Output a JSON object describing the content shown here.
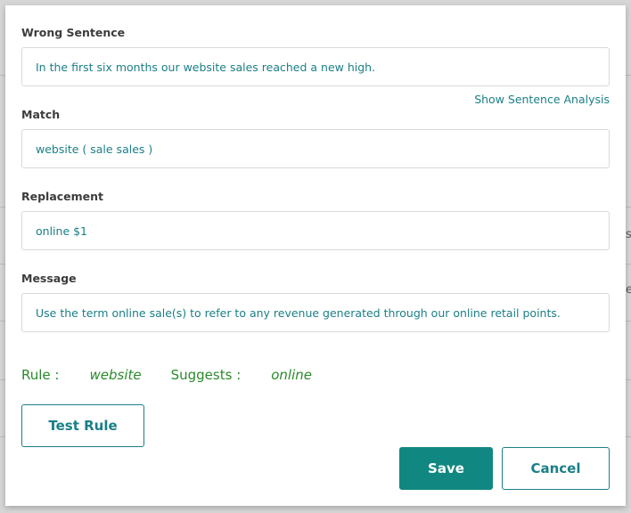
{
  "form": {
    "wrong_sentence": {
      "label": "Wrong Sentence",
      "value": "In the first six months our website sales reached a new high."
    },
    "show_analysis_label": "Show Sentence Analysis",
    "match": {
      "label": "Match",
      "value": "website ( sale sales )"
    },
    "replacement": {
      "label": "Replacement",
      "value": "online $1"
    },
    "message": {
      "label": "Message",
      "value": "Use the term online sale(s) to refer to any revenue generated through our online retail points."
    }
  },
  "rule_summary": {
    "rule_key": "Rule :",
    "rule_value": "website",
    "suggests_key": "Suggests :",
    "suggests_value": "online"
  },
  "buttons": {
    "test_rule": "Test Rule",
    "save": "Save",
    "cancel": "Cancel"
  },
  "background": {
    "glyph_1": "s.",
    "glyph_2": "e"
  },
  "colors": {
    "accent": "#1a7f86",
    "primary_button": "#118781",
    "rule_text": "#2a8a2a"
  }
}
